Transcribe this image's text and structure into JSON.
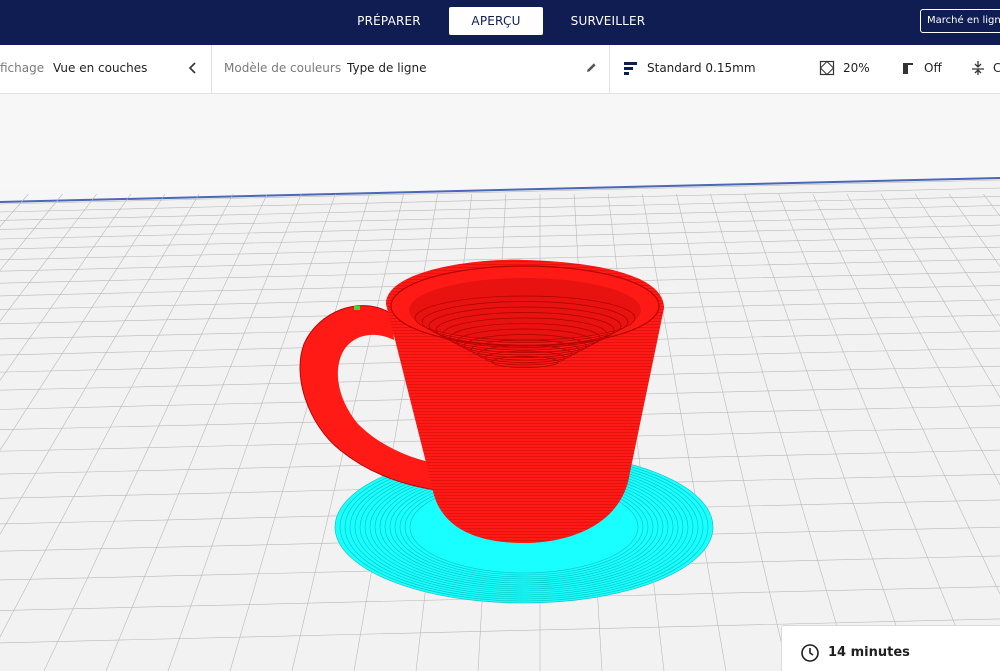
{
  "stages": [
    {
      "label": "PRÉPARER",
      "active": false
    },
    {
      "label": "APERÇU",
      "active": true
    },
    {
      "label": "SURVEILLER",
      "active": false
    }
  ],
  "marketplace": {
    "label": "Marché en ligne"
  },
  "view_type": {
    "label": "fichage",
    "value": "Vue en couches"
  },
  "color_scheme": {
    "label": "Modèle de couleurs",
    "value": "Type de ligne"
  },
  "print_settings": {
    "profile": "Standard 0.15mm",
    "infill": "20%",
    "support": "Off",
    "adhesion": "C"
  },
  "estimate": {
    "time": "14 minutes"
  },
  "colors": {
    "nav_bg": "#0f1d52",
    "model": "#ff1a16",
    "skirt": "#19ffff",
    "grid_line": "#b9b9b9"
  }
}
